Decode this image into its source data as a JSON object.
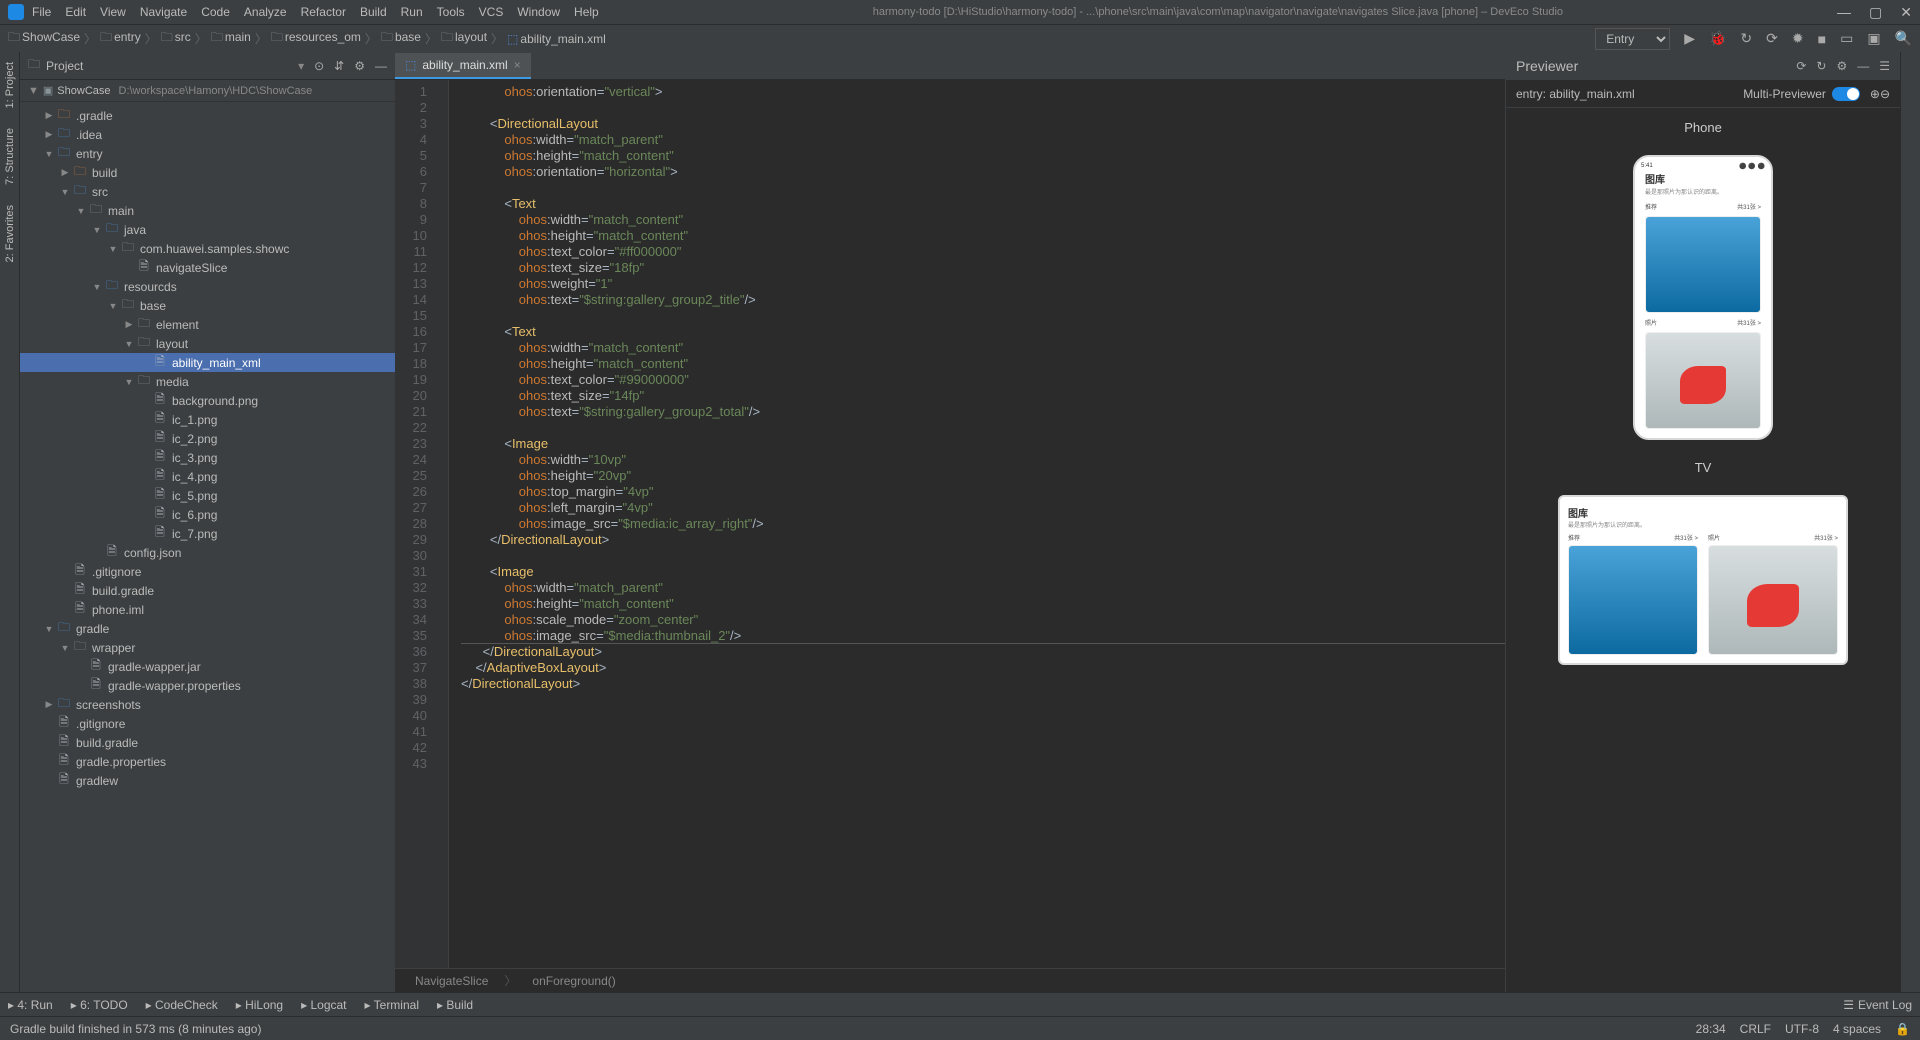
{
  "titlebar": {
    "menus": [
      "File",
      "Edit",
      "View",
      "Navigate",
      "Code",
      "Analyze",
      "Refactor",
      "Build",
      "Run",
      "Tools",
      "VCS",
      "Window",
      "Help"
    ],
    "title": "harmony-todo [D:\\HiStudio\\harmony-todo] - ...\\phone\\src\\main\\java\\com\\map\\navigator\\navigate\\navigates Slice.java [phone] – DevEco Studio"
  },
  "breadcrumbs": [
    "ShowCase",
    "entry",
    "src",
    "main",
    "resources_om",
    "base",
    "layout",
    "ability_main.xml"
  ],
  "run_config": "Entry",
  "left_tabs": [
    "1: Project",
    "7: Structure",
    "2: Favorites"
  ],
  "project": {
    "title": "Project",
    "root": "ShowCase",
    "root_path": "D:\\workspace\\Hamony\\HDC\\ShowCase"
  },
  "tree": [
    {
      "d": 1,
      "t": ".gradle",
      "a": "▶",
      "ic": "dir-o"
    },
    {
      "d": 1,
      "t": ".idea",
      "a": "▶",
      "ic": "dir-b"
    },
    {
      "d": 1,
      "t": "entry",
      "a": "▼",
      "ic": "dir-b"
    },
    {
      "d": 2,
      "t": "build",
      "a": "▶",
      "ic": "dir-o"
    },
    {
      "d": 2,
      "t": "src",
      "a": "▼",
      "ic": "dir-b"
    },
    {
      "d": 3,
      "t": "main",
      "a": "▼",
      "ic": "dir"
    },
    {
      "d": 4,
      "t": "java",
      "a": "▼",
      "ic": "dir-b"
    },
    {
      "d": 5,
      "t": "com.huawei.samples.showc",
      "a": "▼",
      "ic": "dir"
    },
    {
      "d": 6,
      "t": "navigateSlice",
      "a": "",
      "ic": "file",
      "c": "#4b8dda"
    },
    {
      "d": 4,
      "t": "resourcds",
      "a": "▼",
      "ic": "dir-b"
    },
    {
      "d": 5,
      "t": "base",
      "a": "▼",
      "ic": "dir"
    },
    {
      "d": 6,
      "t": "element",
      "a": "▶",
      "ic": "dir"
    },
    {
      "d": 6,
      "t": "layout",
      "a": "▼",
      "ic": "dir"
    },
    {
      "d": 7,
      "t": "ability_main_xml",
      "a": "",
      "ic": "file",
      "sel": true
    },
    {
      "d": 6,
      "t": "media",
      "a": "▼",
      "ic": "dir"
    },
    {
      "d": 7,
      "t": "background.png",
      "a": "",
      "ic": "file"
    },
    {
      "d": 7,
      "t": "ic_1.png",
      "a": "",
      "ic": "file"
    },
    {
      "d": 7,
      "t": "ic_2.png",
      "a": "",
      "ic": "file"
    },
    {
      "d": 7,
      "t": "ic_3.png",
      "a": "",
      "ic": "file"
    },
    {
      "d": 7,
      "t": "ic_4.png",
      "a": "",
      "ic": "file"
    },
    {
      "d": 7,
      "t": "ic_5.png",
      "a": "",
      "ic": "file"
    },
    {
      "d": 7,
      "t": "ic_6.png",
      "a": "",
      "ic": "file"
    },
    {
      "d": 7,
      "t": "ic_7.png",
      "a": "",
      "ic": "file"
    },
    {
      "d": 4,
      "t": "config.json",
      "a": "",
      "ic": "file"
    },
    {
      "d": 2,
      "t": ".gitignore",
      "a": "",
      "ic": "file"
    },
    {
      "d": 2,
      "t": "build.gradle",
      "a": "",
      "ic": "file"
    },
    {
      "d": 2,
      "t": "phone.iml",
      "a": "",
      "ic": "file"
    },
    {
      "d": 1,
      "t": "gradle",
      "a": "▼",
      "ic": "dir-b"
    },
    {
      "d": 2,
      "t": "wrapper",
      "a": "▼",
      "ic": "dir"
    },
    {
      "d": 3,
      "t": "gradle-wapper.jar",
      "a": "",
      "ic": "file"
    },
    {
      "d": 3,
      "t": "gradle-wapper.properties",
      "a": "",
      "ic": "file"
    },
    {
      "d": 1,
      "t": "screenshots",
      "a": "▶",
      "ic": "dir-b"
    },
    {
      "d": 1,
      "t": ".gitignore",
      "a": "",
      "ic": "file"
    },
    {
      "d": 1,
      "t": "build.gradle",
      "a": "",
      "ic": "file"
    },
    {
      "d": 1,
      "t": "gradle.properties",
      "a": "",
      "ic": "file"
    },
    {
      "d": 1,
      "t": "gradlew",
      "a": "",
      "ic": "file"
    }
  ],
  "tab": {
    "name": "ability_main.xml"
  },
  "code_lines": [
    "            <span class='ns'>ohos</span>:<span class='attr'>orientation</span>=<span class='str'>\"vertical\"</span>&gt;",
    "",
    "        &lt;<span class='tag'>DirectionalLayout</span>",
    "            <span class='ns'>ohos</span>:<span class='attr'>width</span>=<span class='str'>\"match_parent\"</span>",
    "            <span class='ns'>ohos</span>:<span class='attr'>height</span>=<span class='str'>\"match_content\"</span>",
    "            <span class='ns'>ohos</span>:<span class='attr'>orientation</span>=<span class='str'>\"horizontal\"</span>&gt;",
    "",
    "            &lt;<span class='tag'>Text</span>",
    "                <span class='ns'>ohos</span>:<span class='attr'>width</span>=<span class='str'>\"match_content\"</span>",
    "                <span class='ns'>ohos</span>:<span class='attr'>height</span>=<span class='str'>\"match_content\"</span>",
    "                <span class='ns'>ohos</span>:<span class='attr'>text_color</span>=<span class='str'>\"#ff000000\"</span>",
    "                <span class='ns'>ohos</span>:<span class='attr'>text_size</span>=<span class='str'>\"18fp\"</span>",
    "                <span class='ns'>ohos</span>:<span class='attr'>weight</span>=<span class='str'>\"1\"</span>",
    "                <span class='ns'>ohos</span>:<span class='attr'>text</span>=<span class='str'>\"$string:gallery_group2_title\"</span>/&gt;",
    "",
    "            &lt;<span class='tag'>Text</span>",
    "                <span class='ns'>ohos</span>:<span class='attr'>width</span>=<span class='str'>\"match_content\"</span>",
    "                <span class='ns'>ohos</span>:<span class='attr'>height</span>=<span class='str'>\"match_content\"</span>",
    "                <span class='ns'>ohos</span>:<span class='attr'>text_color</span>=<span class='str'>\"#99000000\"</span>",
    "                <span class='ns'>ohos</span>:<span class='attr'>text_size</span>=<span class='str'>\"14fp\"</span>",
    "                <span class='ns'>ohos</span>:<span class='attr'>text</span>=<span class='str'>\"$string:gallery_group2_total\"</span>/&gt;",
    "",
    "            &lt;<span class='tag'>Image</span>",
    "                <span class='ns'>ohos</span>:<span class='attr'>width</span>=<span class='str'>\"10vp\"</span>",
    "                <span class='ns'>ohos</span>:<span class='attr'>height</span>=<span class='str'>\"20vp\"</span>",
    "                <span class='ns'>ohos</span>:<span class='attr'>top_margin</span>=<span class='str'>\"4vp\"</span>",
    "                <span class='ns'>ohos</span>:<span class='attr'>left_margin</span>=<span class='str'>\"4vp\"</span>",
    "                <span class='ns'>ohos</span>:<span class='attr'>image_src</span>=<span class='str'>\"$media:ic_array_right\"</span>/&gt;",
    "        &lt;/<span class='tag'>DirectionalLayout</span>&gt;",
    "",
    "        &lt;<span class='tag'>Image</span>",
    "            <span class='ns'>ohos</span>:<span class='attr'>width</span>=<span class='str'>\"match_parent\"</span>",
    "            <span class='ns'>ohos</span>:<span class='attr'>height</span>=<span class='str'>\"match_content\"</span>",
    "            <span class='ns'>ohos</span>:<span class='attr'>scale_mode</span>=<span class='str'>\"zoom_center\"</span>",
    "<span class='sh'>            <span class='ns'>ohos</span>:<span class='attr'>image_src</span>=<span class='str'>\"$media:thumbnail_2\"</span>/&gt;</span>",
    "      &lt;/<span class='tag'>DirectionalLayout</span>&gt;",
    "    &lt;/<span class='tag'>AdaptiveBoxLayout</span>&gt;",
    "&lt;/<span class='tag'>DirectionalLayout</span>&gt;",
    "",
    "",
    "",
    "",
    ""
  ],
  "editor_crumbs": [
    "NavigateSlice",
    "onForeground()"
  ],
  "preview": {
    "title": "Previewer",
    "entry": "entry: ability_main.xml",
    "multi": "Multi-Previewer",
    "devices": [
      "Phone",
      "TV"
    ],
    "gallery": {
      "title": "图库",
      "sub": "最是那照片为那认识的距离。",
      "sec1": "推荐",
      "sec1r": "共31张 >",
      "sec2": "照片",
      "sec2r": "共31张 >"
    }
  },
  "bottom_tools": [
    "4: Run",
    "6: TODO",
    "CodeCheck",
    "HiLong",
    "Logcat",
    "Terminal",
    "Build"
  ],
  "bottom_right": "Event Log",
  "status": {
    "msg": "Gradle build finished in 573 ms (8 minutes ago)",
    "pos": "28:34",
    "sep": "CRLF",
    "enc": "UTF-8",
    "ind": "4 spaces"
  }
}
